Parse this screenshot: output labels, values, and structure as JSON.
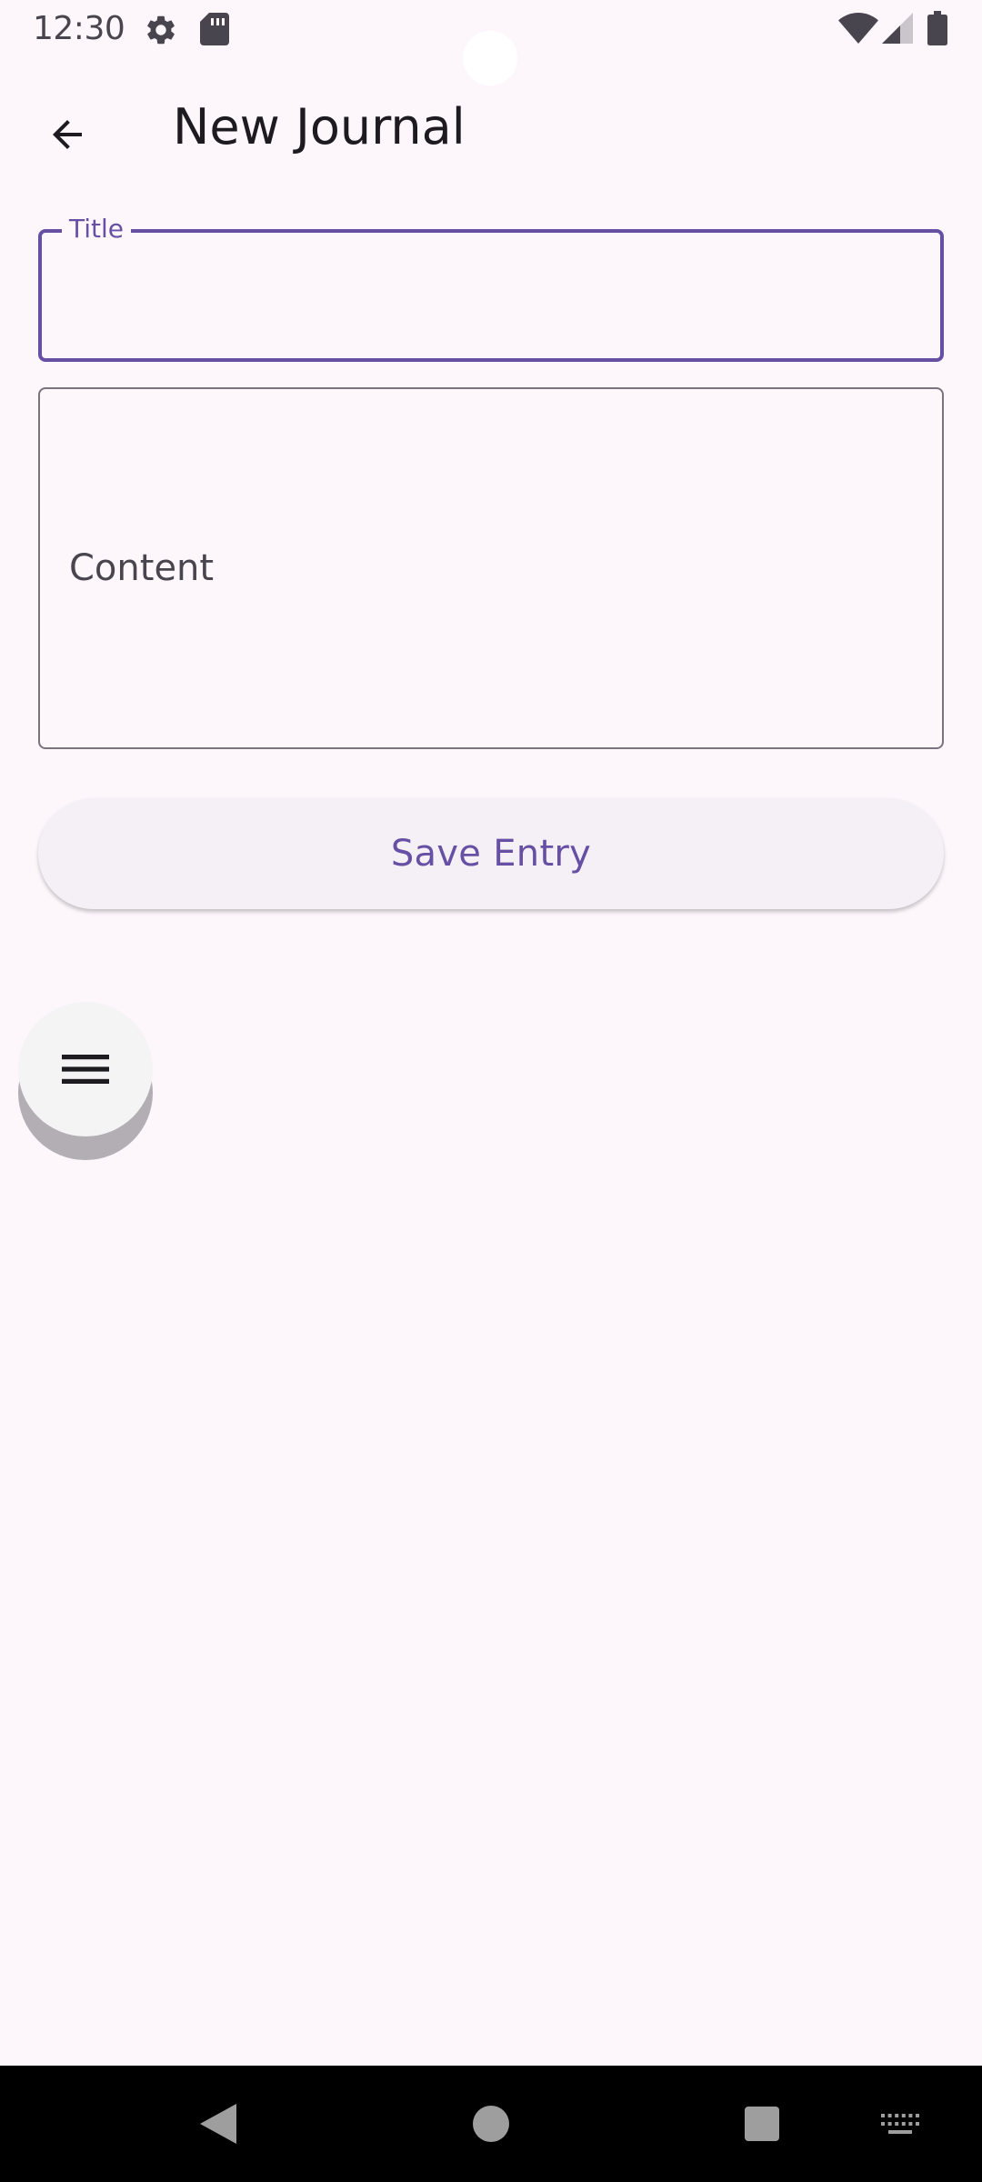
{
  "status_bar": {
    "time": "12:30",
    "icons": [
      "settings-icon",
      "sd-card-icon",
      "wifi-icon",
      "signal-icon",
      "battery-icon"
    ]
  },
  "top_bar": {
    "title": "New Journal",
    "back_icon": "arrow-back-icon"
  },
  "form": {
    "title_field": {
      "label": "Title",
      "value": ""
    },
    "content_field": {
      "placeholder": "Content",
      "value": ""
    },
    "save_label": "Save Entry"
  },
  "fab": {
    "icon": "menu-icon"
  },
  "nav_bar": {
    "buttons": [
      "back-triangle-icon",
      "home-circle-icon",
      "recents-square-icon",
      "keyboard-icon"
    ]
  },
  "colors": {
    "background": "#fdf7fc",
    "accent": "#6750a4",
    "outline": "#79747e",
    "button_surface": "#f4f0f6"
  }
}
